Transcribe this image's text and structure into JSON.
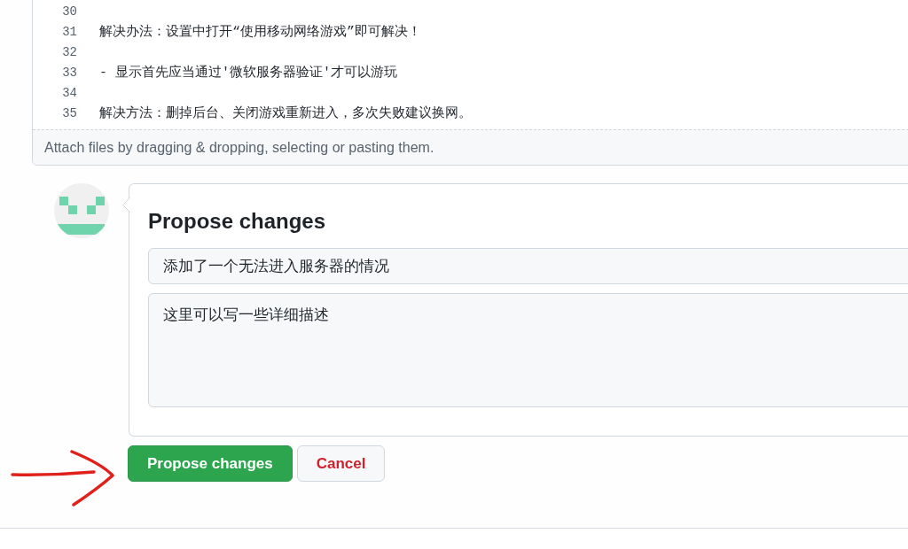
{
  "editor": {
    "lines": [
      {
        "number": "30"
      },
      {
        "number": "31",
        "text": "解决办法：设置中打开“使用移动网络游戏”即可解决！"
      },
      {
        "number": "32"
      },
      {
        "number": "33",
        "text": "- 显示首先应当通过'微软服务器验证'才可以游玩"
      },
      {
        "number": "34"
      },
      {
        "number": "35",
        "text": "解决方法：删掉后台、关闭游戏重新进入，多次失败建议换网。"
      }
    ],
    "attach_hint": "Attach files by dragging & dropping, selecting or pasting them."
  },
  "propose_form": {
    "title": "Propose changes",
    "summary": {
      "value": "添加了一个无法进入服务器的情况"
    },
    "description": {
      "value": "这里可以写一些详细描述"
    }
  },
  "buttons": [
    {
      "label": "Propose changes",
      "kind": "primary"
    },
    {
      "label": "Cancel",
      "kind": "cancel"
    }
  ]
}
